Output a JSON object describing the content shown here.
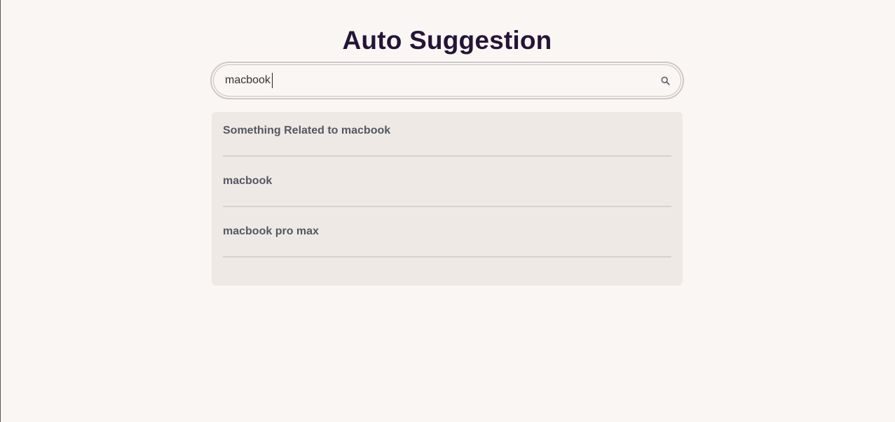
{
  "page": {
    "title": "Auto Suggestion"
  },
  "search": {
    "value": "macbook",
    "icon": "search-icon"
  },
  "suggestions": [
    {
      "label": "Something Related to macbook"
    },
    {
      "label": "macbook"
    },
    {
      "label": "macbook pro max"
    }
  ],
  "colors": {
    "background": "#faf6f4",
    "title": "#261436",
    "panel": "#efe9e6",
    "suggestion_text": "#535861",
    "divider": "#d6d1d0"
  }
}
